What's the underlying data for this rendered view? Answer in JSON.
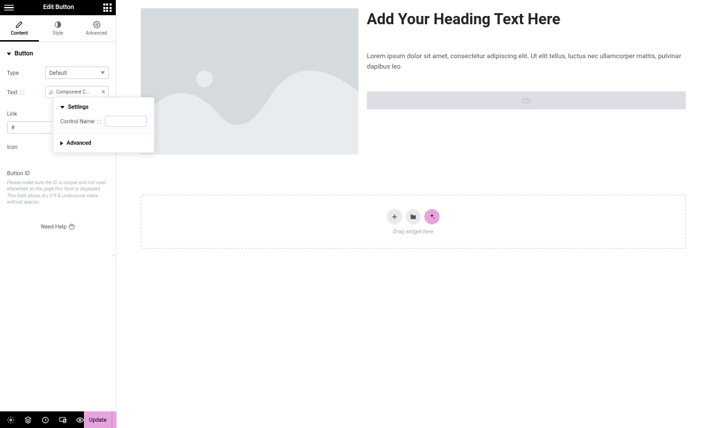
{
  "header": {
    "title": "Edit Button"
  },
  "tabs": {
    "content": "Content",
    "style": "Style",
    "advanced": "Advanced"
  },
  "section": {
    "button": "Button"
  },
  "fields": {
    "type_label": "Type",
    "type_value": "Default",
    "text_label": "Text",
    "text_value": "Component C...",
    "link_label": "Link",
    "link_value": "#",
    "icon_label": "Icon",
    "button_id_label": "Button ID",
    "button_id_hint": "Please make sure the ID is unique and not used elsewhere on the page this form is displayed. This field allows A-z 0-9 & underscore chars without spaces."
  },
  "popover": {
    "settings": "Settings",
    "control_name": "Control Name",
    "advanced": "Advanced"
  },
  "need_help": "Need Help",
  "footer": {
    "update": "Update"
  },
  "canvas": {
    "heading": "Add Your Heading Text Here",
    "paragraph": "Lorem ipsum dolor sit amet, consectetur adipiscing elit. Ut elit tellus, luctus nec ullamcorper mattis, pulvinar dapibus leo.",
    "drag_text": "Drag widget here"
  }
}
